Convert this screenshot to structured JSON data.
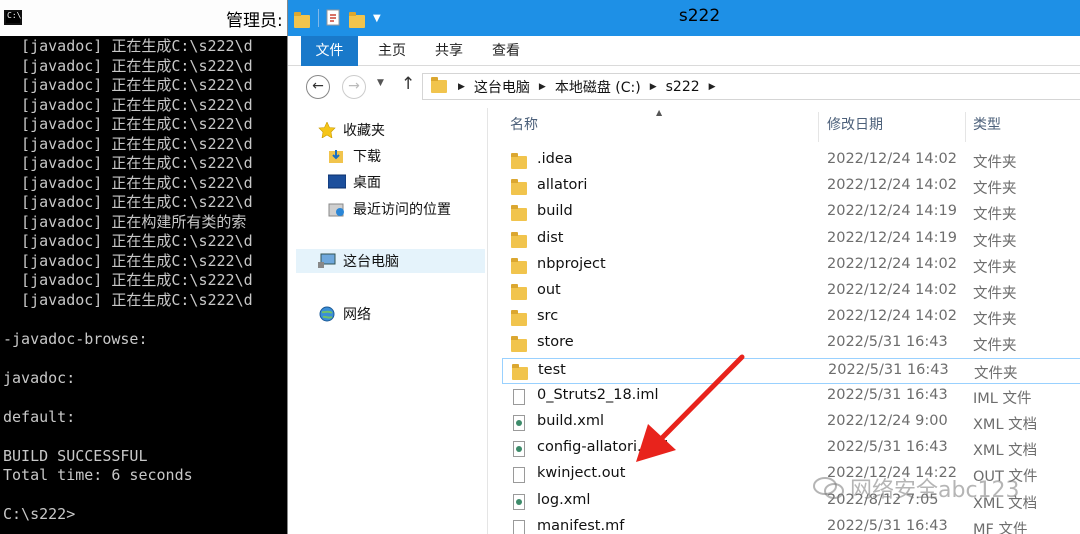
{
  "cmd": {
    "title": "管理员:",
    "icon": "cmd-icon",
    "lines": [
      "  [javadoc] 正在生成C:\\s222\\d",
      "  [javadoc] 正在生成C:\\s222\\d",
      "  [javadoc] 正在生成C:\\s222\\d",
      "  [javadoc] 正在生成C:\\s222\\d",
      "  [javadoc] 正在生成C:\\s222\\d",
      "  [javadoc] 正在生成C:\\s222\\d",
      "  [javadoc] 正在生成C:\\s222\\d",
      "  [javadoc] 正在生成C:\\s222\\d",
      "  [javadoc] 正在生成C:\\s222\\d",
      "  [javadoc] 正在构建所有类的索",
      "  [javadoc] 正在生成C:\\s222\\d",
      "  [javadoc] 正在生成C:\\s222\\d",
      "  [javadoc] 正在生成C:\\s222\\d",
      "  [javadoc] 正在生成C:\\s222\\d",
      "",
      "-javadoc-browse:",
      "",
      "javadoc:",
      "",
      "default:",
      "",
      "BUILD SUCCESSFUL",
      "Total time: 6 seconds",
      "",
      "C:\\s222>"
    ]
  },
  "explorer": {
    "title": "s222",
    "tabs": {
      "file": "文件",
      "home": "主页",
      "share": "共享",
      "view": "查看"
    },
    "address": {
      "crumbs": [
        "这台电脑",
        "本地磁盘 (C:)",
        "s222"
      ]
    },
    "nav": {
      "favorites": "收藏夹",
      "downloads": "下载",
      "desktop": "桌面",
      "recent": "最近访问的位置",
      "this_pc": "这台电脑",
      "network": "网络"
    },
    "columns": {
      "name": "名称",
      "date": "修改日期",
      "type": "类型"
    },
    "files": [
      {
        "name": ".idea",
        "date": "2022/12/24 14:02",
        "type": "文件夹",
        "kind": "folder"
      },
      {
        "name": "allatori",
        "date": "2022/12/24 14:02",
        "type": "文件夹",
        "kind": "folder"
      },
      {
        "name": "build",
        "date": "2022/12/24 14:19",
        "type": "文件夹",
        "kind": "folder"
      },
      {
        "name": "dist",
        "date": "2022/12/24 14:19",
        "type": "文件夹",
        "kind": "folder"
      },
      {
        "name": "nbproject",
        "date": "2022/12/24 14:02",
        "type": "文件夹",
        "kind": "folder"
      },
      {
        "name": "out",
        "date": "2022/12/24 14:02",
        "type": "文件夹",
        "kind": "folder"
      },
      {
        "name": "src",
        "date": "2022/12/24 14:02",
        "type": "文件夹",
        "kind": "folder"
      },
      {
        "name": "store",
        "date": "2022/5/31 16:43",
        "type": "文件夹",
        "kind": "folder"
      },
      {
        "name": "test",
        "date": "2022/5/31 16:43",
        "type": "文件夹",
        "kind": "folder"
      },
      {
        "name": "0_Struts2_18.iml",
        "date": "2022/5/31 16:43",
        "type": "IML 文件",
        "kind": "doc"
      },
      {
        "name": "build.xml",
        "date": "2022/12/24 9:00",
        "type": "XML 文档",
        "kind": "xml"
      },
      {
        "name": "config-allatori.xml",
        "date": "2022/5/31 16:43",
        "type": "XML 文档",
        "kind": "xml"
      },
      {
        "name": "kwinject.out",
        "date": "2022/12/24 14:22",
        "type": "OUT 文件",
        "kind": "doc"
      },
      {
        "name": "log.xml",
        "date": "2022/8/12 7:05",
        "type": "XML 文档",
        "kind": "xml"
      },
      {
        "name": "manifest.mf",
        "date": "2022/5/31 16:43",
        "type": "MF 文件",
        "kind": "doc"
      }
    ],
    "selected_row": "test"
  },
  "annotation": {
    "arrow_color": "#e8231c"
  },
  "watermark": {
    "text": "网络安全abc123",
    "icon": "wechat-icon"
  },
  "colors": {
    "titlebar": "#1e90e6",
    "file_tab": "#1979ca",
    "selection": "#e5f3fb",
    "column_header": "#4c607a"
  }
}
